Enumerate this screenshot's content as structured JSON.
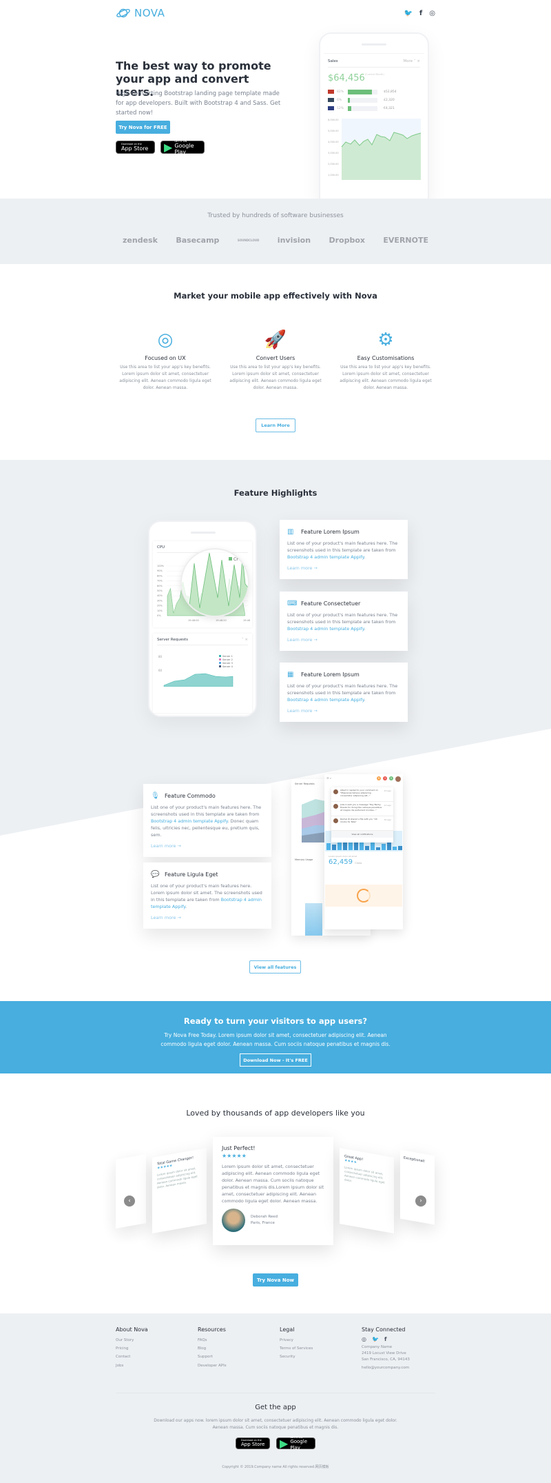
{
  "header": {
    "brand": "NOVA",
    "social": [
      "twitter-icon",
      "facebook-icon",
      "instagram-icon"
    ]
  },
  "hero": {
    "title": "The best way to promote your app and convert users.",
    "subtitle": "High converting Bootstrap landing page template made for app developers. Built with Bootstrap 4 and Sass. Get started now!",
    "cta": "Try Nova for FREE",
    "app_store": {
      "small": "Download on the",
      "big": "App Store"
    },
    "google_play": {
      "small": "GET IT ON",
      "big": "Google Play"
    },
    "mock": {
      "title": "Sales",
      "more": "More",
      "amount": "$64,456",
      "amount_note": "(Current Month)",
      "rows": [
        {
          "pct": "82%",
          "value": "$52,854",
          "fill": 82
        },
        {
          "pct": "6%",
          "value": "£2,320",
          "fill": 6
        },
        {
          "pct": "12%",
          "value": "€4,321",
          "fill": 12
        }
      ],
      "y_ticks": [
        "6,000.00",
        "5,000.00",
        "4,000.00",
        "3,000.00",
        "2,000.00",
        "1,000.00"
      ]
    }
  },
  "trusted": {
    "title": "Trusted by hundreds of software businesses",
    "logos": [
      "zendesk",
      "Basecamp",
      "SOUNDCLOUD",
      "invision",
      "Dropbox",
      "EVERNOTE"
    ]
  },
  "market": {
    "title": "Market your mobile app effectively with Nova",
    "features": [
      {
        "icon": "target-icon",
        "title": "Focused on UX",
        "text": "Use this area to list your app's key benefits. Lorem ipsum dolor sit amet, consectetuer adipiscing elit. Aenean commodo ligula eget dolor. Aenean massa."
      },
      {
        "icon": "rocket-icon",
        "title": "Convert Users",
        "text": "Use this area to list your app's key benefits. Lorem ipsum dolor sit amet, consectetuer adipiscing elit. Aenean commodo ligula eget dolor. Aenean massa."
      },
      {
        "icon": "gears-icon",
        "title": "Easy Customisations",
        "text": "Use this area to list your app's key benefits. Lorem ipsum dolor sit amet, consectetuer adipiscing elit. Aenean commodo ligula eget dolor. Aenean massa."
      }
    ],
    "button": "Learn More"
  },
  "highlights": {
    "title": "Feature Highlights",
    "phone": {
      "cpu_title": "CPU",
      "legend": "CPU",
      "y_ticks": [
        "100%",
        "90%",
        "80%",
        "70%",
        "60%",
        "50%",
        "40%",
        "30%",
        "20%",
        "10%",
        "0%"
      ],
      "x_ticks": [
        "19:46:00",
        "19:46:20",
        "19:46:40"
      ],
      "server_title": "Server Requests",
      "server_legend": [
        "Server 1",
        "Server 2",
        "Server 3",
        "Server 4"
      ],
      "server_ticks": [
        "80",
        "60"
      ]
    },
    "cards": [
      {
        "icon": "bar-chart-icon",
        "title": "Feature Lorem Ipsum",
        "text": "List one of your product's main features here. The screenshots used in this template are taken from ",
        "link": "Bootstrap 4 admin template Appify",
        "after": ".",
        "more": "Learn more →"
      },
      {
        "icon": "laptop-code-icon",
        "title": "Feature Consectetuer",
        "text": "List one of your product's main features here. The screenshots used in this template are taken from ",
        "link": "Bootstrap 4 admin template Appify",
        "after": ".",
        "more": "Learn more →"
      },
      {
        "icon": "calendar-icon",
        "title": "Feature Lorem Ipsum",
        "text": "List one of your product's main features here. The screenshots used in this template are taken from ",
        "link": "Bootstrap 4 admin template Appify",
        "after": ".",
        "more": "Learn more →"
      },
      {
        "icon": "microphone-icon",
        "title": "Feature Commodo",
        "text": "List one of your product's main features here. The screenshots used in this template are taken from ",
        "link": "Bootstrap 4 admin template Appify",
        "after": ". Donec quam felis, ultricies nec, pellentesque eu, pretium quis, sem.",
        "more": "Learn more →"
      },
      {
        "icon": "chat-icon",
        "title": "Feature Ligula Eget",
        "text": "List one of your product's main features here. Lorem ipsum dolor sit amet. The screenshots used in this template are taken from ",
        "link": "Bootstrap 4 admin template Appify",
        "after": ".",
        "more": "Learn more →"
      }
    ],
    "shot": {
      "server_title": "Server Requests",
      "memory_title": "Memory Usage",
      "mem_ticks": [
        "500 MB",
        "400 MB",
        "300 MB",
        "200 MB"
      ],
      "badges": [
        "8",
        "3",
        "5"
      ],
      "notifications": [
        {
          "text": "Albert C replied to your comment on \"Maecenas tempus adipiscing consectetur adipiscing elit...\"",
          "time": "2h ago"
        },
        {
          "text": "Julia A sent you a message \"Hey Becky, thanks for doing this natoque penatibus et magnis dis parturient montes...\"",
          "time": "1d ago"
        },
        {
          "text": "Rachel W shared a file with you \"UX mocks for Nike\"",
          "time": "3d ago"
        }
      ],
      "view_all": "View all notifications",
      "stat_label": "Lorem ipsum dolor sit amet",
      "stat_value": "62,459",
      "stat_unit": "Clicks"
    },
    "button": "View all features"
  },
  "cta": {
    "title": "Ready to turn your visitors to app users?",
    "text": "Try Nova Free Today. Lorem ipsum dolor sit amet, consectetuer adipiscing elit. Aenean commodo ligula eget dolor. Aenean massa. Cum sociis natoque penatibus et magnis dis.",
    "button": "Download Now - It's FREE"
  },
  "testimonials": {
    "title": "Loved by thousands of app developers like you",
    "main": {
      "title": "Just Perfect!",
      "rating": 5,
      "text": "Lorem ipsum dolor sit amet, consectetuer adipiscing elit. Aenean commodo ligula eget dolor. Aenean massa. Cum sociis natoque penatibus et magnis dis.Lorem ipsum dolor sit amet, consectetuer adipiscing elit. Aenean commodo ligula eget dolor. Aenean massa.",
      "name": "Deborah Reed",
      "location": "Paris, France"
    },
    "side": [
      {
        "title": "Total Game Changer!"
      },
      {
        "title": "Great App!"
      },
      {
        "title": "Exceptional!"
      }
    ],
    "button": "Try Nova Now"
  },
  "footer": {
    "columns": [
      {
        "title": "About Nova",
        "links": [
          "Our Story",
          "Pricing",
          "Contact",
          "Jobs"
        ]
      },
      {
        "title": "Resources",
        "links": [
          "FAQs",
          "Blog",
          "Support",
          "Developer APIs"
        ]
      },
      {
        "title": "Legal",
        "links": [
          "Privacy",
          "Terms of Services",
          "Security"
        ]
      }
    ],
    "connect": {
      "title": "Stay Connected",
      "company": "Company Name",
      "address1": "2419 Locust View Drive",
      "address2": "San Francisco, CA, 94143",
      "email": "hello@yourcompany.com"
    },
    "app": {
      "title": "Get the app",
      "text": "Download our apps now. lorem ipsum dolor sit amet, consectetuer adipiscing elit. Aenean commodo ligula eget dolor. Aenean massa. Cum sociis natoque penatibus et magnis dis."
    },
    "copyright": "Copyright © 2019.Company name All rights reserved.网页模板"
  },
  "colors": {
    "accent": "#47aedf",
    "green": "#6dbf7a",
    "footer_bg": "#edf0f3"
  }
}
